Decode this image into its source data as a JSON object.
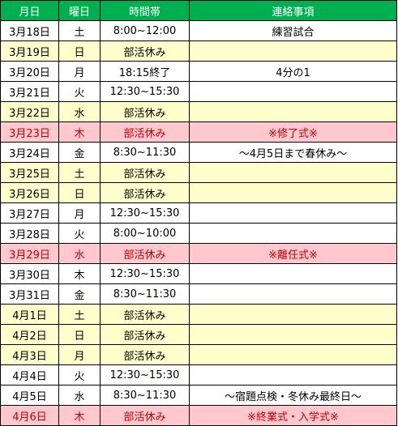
{
  "headers": [
    "月日",
    "曜日",
    "時間帯",
    "連絡事項"
  ],
  "colors": {
    "header": "#00b050",
    "off_day": "#ffffcc",
    "event_day": "#ffc7ce",
    "event_text": "#c00000"
  },
  "rows": [
    {
      "date": "3月18日",
      "day": "土",
      "time": "8:00~12:00",
      "note": "練習試合",
      "type": "normal"
    },
    {
      "date": "3月19日",
      "day": "日",
      "time": "部活休み",
      "note": "",
      "type": "off"
    },
    {
      "date": "3月20日",
      "day": "月",
      "time": "18:15終了",
      "note": "4分の1",
      "type": "normal"
    },
    {
      "date": "3月21日",
      "day": "火",
      "time": "12:30~15:30",
      "note": "",
      "type": "normal"
    },
    {
      "date": "3月22日",
      "day": "水",
      "time": "部活休み",
      "note": "",
      "type": "off"
    },
    {
      "date": "3月23日",
      "day": "木",
      "time": "部活休み",
      "note": "※修了式※",
      "type": "event"
    },
    {
      "date": "3月24日",
      "day": "金",
      "time": "8:30~11:30",
      "note": "～4月5日まで春休み～",
      "type": "normal"
    },
    {
      "date": "3月25日",
      "day": "土",
      "time": "部活休み",
      "note": "",
      "type": "off"
    },
    {
      "date": "3月26日",
      "day": "日",
      "time": "部活休み",
      "note": "",
      "type": "off"
    },
    {
      "date": "3月27日",
      "day": "月",
      "time": "12:30~15:30",
      "note": "",
      "type": "normal"
    },
    {
      "date": "3月28日",
      "day": "火",
      "time": "8:00~10:00",
      "note": "",
      "type": "normal"
    },
    {
      "date": "3月29日",
      "day": "水",
      "time": "部活休み",
      "note": "※離任式※",
      "type": "event"
    },
    {
      "date": "3月30日",
      "day": "木",
      "time": "12:30~15:30",
      "note": "",
      "type": "normal"
    },
    {
      "date": "3月31日",
      "day": "金",
      "time": "8:30~11:30",
      "note": "",
      "type": "normal"
    },
    {
      "date": "4月1日",
      "day": "土",
      "time": "部活休み",
      "note": "",
      "type": "off"
    },
    {
      "date": "4月2日",
      "day": "日",
      "time": "部活休み",
      "note": "",
      "type": "off"
    },
    {
      "date": "4月3日",
      "day": "月",
      "time": "部活休み",
      "note": "",
      "type": "off"
    },
    {
      "date": "4月4日",
      "day": "火",
      "time": "12:30~15:30",
      "note": "",
      "type": "normal"
    },
    {
      "date": "4月5日",
      "day": "水",
      "time": "8:30~11:30",
      "note": "～宿題点検・冬休み最終日～",
      "type": "normal"
    },
    {
      "date": "4月6日",
      "day": "木",
      "time": "部活休み",
      "note": "※終業式・入学式※",
      "type": "event"
    }
  ]
}
